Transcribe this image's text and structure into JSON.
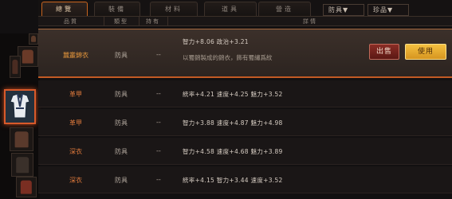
{
  "tabs": [
    {
      "label": "總覽",
      "active": true
    },
    {
      "label": "裝備",
      "active": false
    },
    {
      "label": "材料",
      "active": false
    },
    {
      "label": "道具",
      "active": false
    },
    {
      "label": "營造",
      "active": false
    }
  ],
  "filters": {
    "category": "防具▼",
    "rarity": "珍品▼"
  },
  "columns": {
    "quality": "品質",
    "type": "類型",
    "owned": "持有",
    "details": "詳情"
  },
  "rows": [
    {
      "name": "蠶叢錦衣",
      "type": "防具",
      "owned": "--",
      "stats": "智力+8.06  政治+3.21",
      "description": "以蜀錦製成的錦衣，飾有蜀繡爲紋",
      "selected": true
    },
    {
      "name": "革甲",
      "type": "防具",
      "owned": "--",
      "stats": "統率+4.21  速度+4.25  魅力+3.52",
      "selected": false
    },
    {
      "name": "革甲",
      "type": "防具",
      "owned": "--",
      "stats": "智力+3.88  速度+4.87  魅力+4.98",
      "selected": false
    },
    {
      "name": "深衣",
      "type": "防具",
      "owned": "--",
      "stats": "智力+4.58  速度+4.68  魅力+3.89",
      "selected": false
    },
    {
      "name": "深衣",
      "type": "防具",
      "owned": "--",
      "stats": "統率+4.15  智力+3.44  速度+3.52",
      "selected": false
    }
  ],
  "actions": {
    "sell": "出售",
    "use": "使用"
  },
  "thumbnails": [
    {
      "icon": "armor-thumbnail-icon",
      "color": "#3a2a22"
    },
    {
      "icon": "armor-thumbnail-icon",
      "color": "#4a3024"
    },
    {
      "icon": "robe-thumbnail-icon",
      "color": "#2a3a4a",
      "selected": true
    },
    {
      "icon": "armor-thumbnail-icon",
      "color": "#3a2c26"
    },
    {
      "icon": "armor-thumbnail-icon",
      "color": "#302822"
    },
    {
      "icon": "armor-thumbnail-icon",
      "color": "#2e2622"
    },
    {
      "icon": "armor-thumbnail-icon",
      "color": "#4a2a22"
    }
  ]
}
